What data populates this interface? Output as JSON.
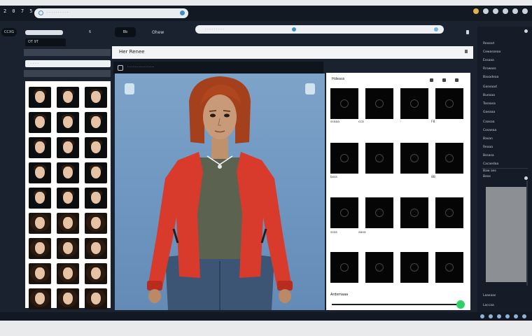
{
  "app": {
    "brand": "2 0 7 5"
  },
  "search": {
    "text": "· · · · · · · · · ·"
  },
  "address": {
    "text": "· · · · · · · · ·"
  },
  "toolbar": {
    "pill": "CCXG",
    "num": "6",
    "tab_selected": "Bb",
    "tab2": "Ohew"
  },
  "breadcrumb": "OT 9T",
  "left": {
    "search_text": "· · · ·"
  },
  "center": {
    "title": "Her Renee",
    "tool_text": "····················"
  },
  "rpanel": {
    "head": "Hdeass",
    "foot": "Ardsmaaa",
    "labels": [
      [
        "ssaaa",
        "cca",
        "·",
        "F8"
      ],
      [
        "bsss",
        "",
        "",
        "8B"
      ],
      [
        "sssa",
        "aasa",
        "",
        ""
      ],
      [
        "",
        "",
        "",
        ""
      ]
    ]
  },
  "rsidebar": {
    "items": [
      "Reassd",
      "Cewasseao",
      "Essaaa",
      "Rrowass",
      "Baxadeaa",
      "Gaseaad",
      "Bueaaa",
      "Tasaasa",
      "Gaeaaa",
      "Caasaa",
      "Cosaeaa",
      "Basan",
      "Reaaa",
      "Bssasa",
      "Cacaedaa",
      "Baw aes"
    ],
    "section2": "Beas",
    "bottom1": "Laasaas",
    "bottom2": "Laccaa"
  }
}
